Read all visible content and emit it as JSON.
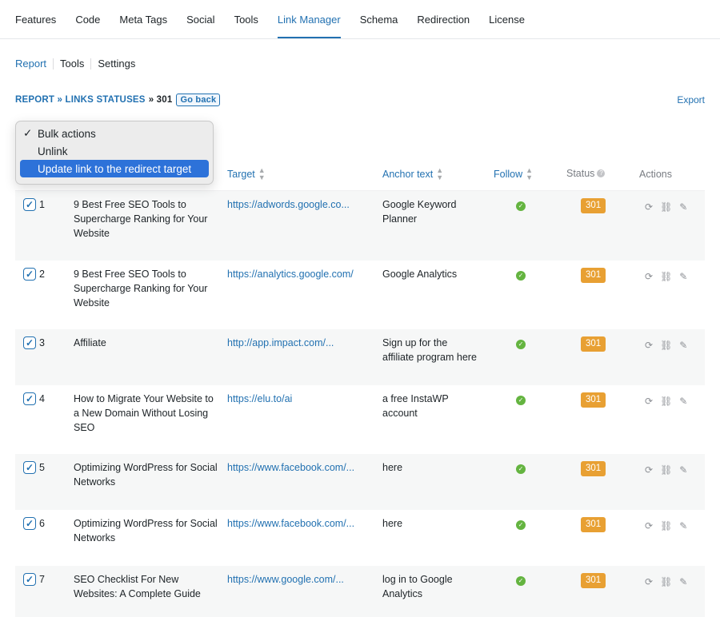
{
  "topnav": {
    "tabs": [
      {
        "label": "Features"
      },
      {
        "label": "Code"
      },
      {
        "label": "Meta Tags"
      },
      {
        "label": "Social"
      },
      {
        "label": "Tools"
      },
      {
        "label": "Link Manager"
      },
      {
        "label": "Schema"
      },
      {
        "label": "Redirection"
      },
      {
        "label": "License"
      }
    ]
  },
  "subnav": {
    "report": "Report",
    "tools": "Tools",
    "settings": "Settings"
  },
  "breadcrumb": {
    "report": "REPORT",
    "sep": "»",
    "links_statuses": "LINKS STATUSES",
    "current": "» 301",
    "go_back": "Go back"
  },
  "export_label": "Export",
  "bulk_menu": {
    "options": [
      {
        "label": "Bulk actions",
        "checked": "✓"
      },
      {
        "label": "Unlink",
        "checked": ""
      },
      {
        "label": "Update link to the redirect target",
        "checked": ""
      }
    ]
  },
  "table": {
    "headers": {
      "target": "Target",
      "anchor": "Anchor text",
      "follow": "Follow",
      "status": "Status",
      "actions": "Actions"
    },
    "rows": [
      {
        "num": "1",
        "title": "9 Best Free SEO Tools to Supercharge Ranking for Your Website",
        "target": "https://adwords.google.co...",
        "anchor": "Google Keyword Planner",
        "status": "301"
      },
      {
        "num": "2",
        "title": "9 Best Free SEO Tools to Supercharge Ranking for Your Website",
        "target": "https://analytics.google.com/",
        "anchor": "Google Analytics",
        "status": "301"
      },
      {
        "num": "3",
        "title": "Affiliate",
        "target": "http://app.impact.com/...",
        "anchor": "Sign up for the affiliate program here",
        "status": "301"
      },
      {
        "num": "4",
        "title": "How to Migrate Your Website to a New Domain Without Losing SEO",
        "target": "https://elu.to/ai",
        "anchor": "a free InstaWP account",
        "status": "301"
      },
      {
        "num": "5",
        "title": "Optimizing WordPress for Social Networks",
        "target": "https://www.facebook.com/...",
        "anchor": "here",
        "status": "301"
      },
      {
        "num": "6",
        "title": "Optimizing WordPress for Social Networks",
        "target": "https://www.facebook.com/...",
        "anchor": "here",
        "status": "301"
      },
      {
        "num": "7",
        "title": "SEO Checklist For New Websites: A Complete Guide",
        "target": "https://www.google.com/...",
        "anchor": "log in to Google Analytics",
        "status": "301"
      }
    ]
  },
  "colors": {
    "accent": "#2271b1",
    "status_301": "#e8a033",
    "follow_ok": "#64b440",
    "menu_highlight": "#2d72d9"
  }
}
